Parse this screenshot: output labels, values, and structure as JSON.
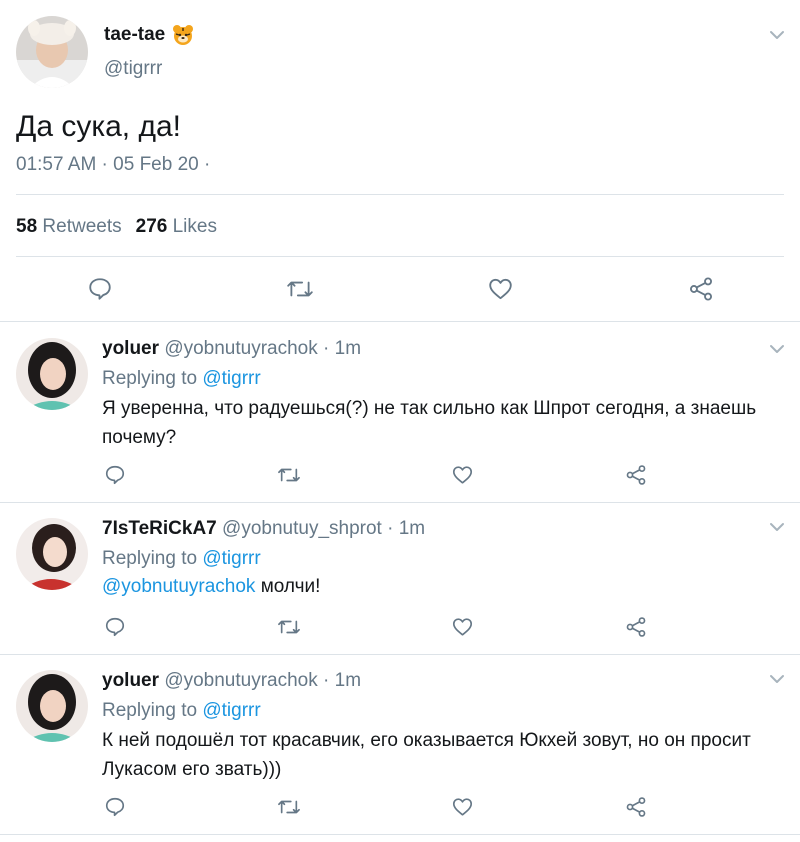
{
  "tweet": {
    "display_name": "tae-tae",
    "handle": "@tigrrr",
    "text": "Да сука, да!",
    "timestamp": "01:57 AM · 05 Feb 20 ·",
    "retweets_count": "58",
    "retweets_label": "Retweets",
    "likes_count": "276",
    "likes_label": "Likes"
  },
  "replies": [
    {
      "name": "yoluer",
      "handle": "@yobnutuyrachok",
      "time": "· 1m",
      "replying_prefix": "Replying to",
      "replying_to": "@tigrrr",
      "mention": "",
      "text": "Я уверенна, что радуешься(?) не так сильно как Шпрот сегодня, а знаешь почему?"
    },
    {
      "name": "7IsTeRiCkA7",
      "handle": "@yobnutuy_shprot",
      "time": "· 1m",
      "replying_prefix": "Replying to",
      "replying_to": "@tigrrr",
      "mention": "@yobnutuyrachok",
      "text": " молчи!"
    },
    {
      "name": "yoluer",
      "handle": "@yobnutuyrachok",
      "time": "· 1m",
      "replying_prefix": "Replying to",
      "replying_to": "@tigrrr",
      "mention": "",
      "text": "К ней подошёл тот красавчик, его оказывается Юкхей зовут, но он просит Лукасом его звать)))"
    }
  ],
  "icons": {
    "reply": "reply-icon",
    "retweet": "retweet-icon",
    "like": "heart-icon",
    "share": "share-icon",
    "menu": "chevron-down-icon",
    "emoji": "tiger-emoji"
  },
  "colors": {
    "link": "#1b95e0",
    "secondary_text": "#657786",
    "divider": "#dde3e8"
  }
}
